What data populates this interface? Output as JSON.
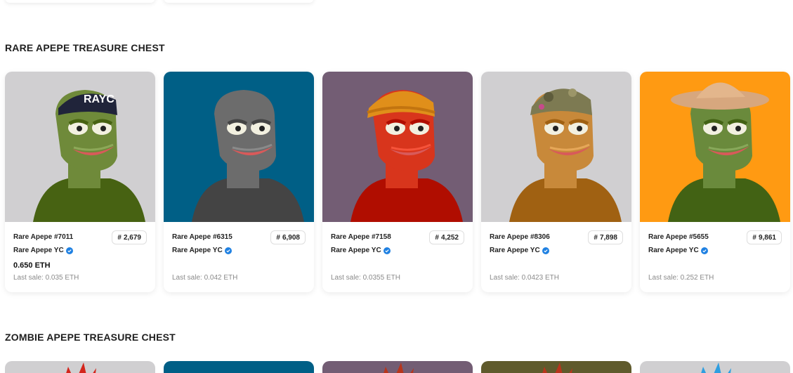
{
  "sections": [
    {
      "title": "RARE APEPE TREASURE CHEST",
      "cards": [
        {
          "name": "Rare Apepe #7011",
          "rank": "2,679",
          "collection": "Rare Apepe YC",
          "price": "0.650 ETH",
          "last_sale": "Last sale: 0.035 ETH",
          "bg": "#d0cfd1",
          "skin": "#6f8a3a",
          "hat": "cap",
          "hat_text": "RAYC"
        },
        {
          "name": "Rare Apepe #6315",
          "rank": "6,908",
          "collection": "Rare Apepe YC",
          "price": "",
          "last_sale": "Last sale: 0.042 ETH",
          "bg": "#005f86",
          "skin": "#6c6c6c",
          "hat": "none",
          "hat_text": ""
        },
        {
          "name": "Rare Apepe #7158",
          "rank": "4,252",
          "collection": "Rare Apepe YC",
          "price": "",
          "last_sale": "Last sale: 0.0355 ETH",
          "bg": "#735d74",
          "skin": "#d8351c",
          "hat": "beanie",
          "hat_text": ""
        },
        {
          "name": "Rare Apepe #8306",
          "rank": "7,898",
          "collection": "Rare Apepe YC",
          "price": "",
          "last_sale": "Last sale: 0.0423 ETH",
          "bg": "#d0cfd1",
          "skin": "#c8893a",
          "hat": "camo",
          "hat_text": ""
        },
        {
          "name": "Rare Apepe #5655",
          "rank": "9,861",
          "collection": "Rare Apepe YC",
          "price": "",
          "last_sale": "Last sale: 0.252 ETH",
          "bg": "#ff9a12",
          "skin": "#6a8a3c",
          "hat": "cowboy",
          "hat_text": ""
        }
      ]
    },
    {
      "title": "ZOMBIE APEPE TREASURE CHEST",
      "cards": [
        {
          "bg": "#d0cfd1",
          "accent": "#d4251c"
        },
        {
          "bg": "#005f86",
          "accent": ""
        },
        {
          "bg": "#735d74",
          "accent": "#b8351c"
        },
        {
          "bg": "#5f5a2c",
          "accent": "#b8351c"
        },
        {
          "bg": "#d0cfd1",
          "accent": "#2f9ee0"
        }
      ]
    }
  ],
  "icons": {
    "rank": "hash-icon",
    "verified": "verified-badge-icon"
  },
  "colors": {
    "verified": "#2081e2",
    "muted_text": "#8a8a8a"
  }
}
